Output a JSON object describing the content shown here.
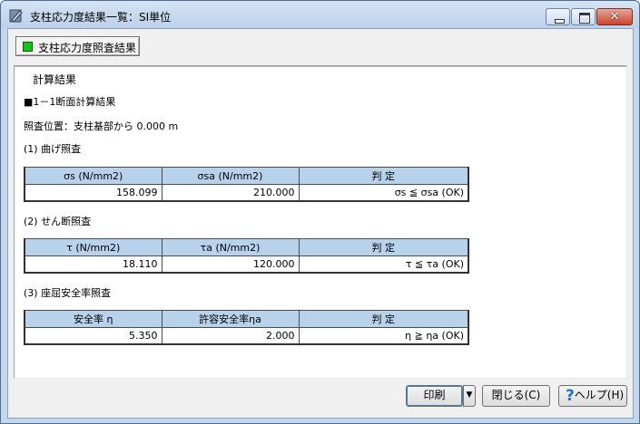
{
  "window": {
    "title": "支柱応力度結果一覧：SI単位",
    "icons": {
      "app": "app-icon",
      "minimize": "minimize-icon",
      "maximize": "maximize-icon",
      "close": "close-icon"
    }
  },
  "toolbar": {
    "check_button_label": "支柱応力度照査結果",
    "check_color": "#19c219"
  },
  "content": {
    "group_title": "計算結果",
    "section_title": "■1－1断面計算結果",
    "position_label": "照査位置：支柱基部から 0.000 m",
    "bending": {
      "heading": "(1) 曲げ照査",
      "headers": [
        "σs (N/mm2)",
        "σsa (N/mm2)",
        "判 定"
      ],
      "row": [
        "158.099",
        "210.000",
        "σs ≦ σsa (OK)"
      ]
    },
    "shear": {
      "heading": "(2) せん断照査",
      "headers": [
        "τ (N/mm2)",
        "τa (N/mm2)",
        "判 定"
      ],
      "row": [
        "18.110",
        "120.000",
        "τ ≦ τa (OK)"
      ]
    },
    "buckling": {
      "heading": "(3) 座屈安全率照査",
      "headers": [
        "安全率 η",
        "許容安全率ηa",
        "判 定"
      ],
      "row": [
        "5.350",
        "2.000",
        "η ≧ ηa (OK)"
      ]
    },
    "header_color": "#b7d2ea"
  },
  "buttons": {
    "print": "印刷",
    "print_dropdown": "▼",
    "close": "閉じる(C)",
    "help": "ヘルプ(H)",
    "help_icon": "question-icon"
  }
}
